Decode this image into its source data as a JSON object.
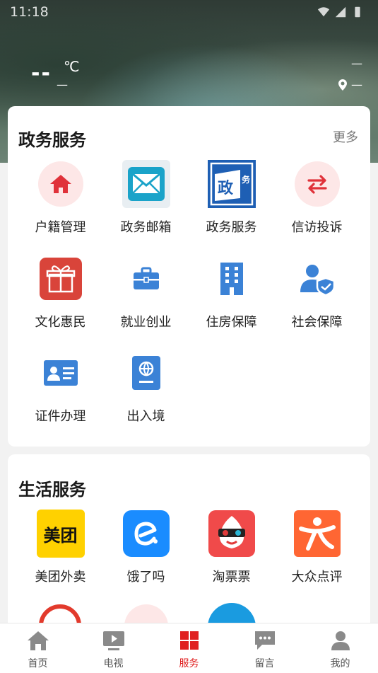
{
  "status_bar": {
    "time": "11:18"
  },
  "weather": {
    "temperature": "--",
    "unit": "℃",
    "description": "—",
    "right_top": "—",
    "location": "—"
  },
  "gov_services": {
    "title": "政务服务",
    "more": "更多",
    "items": [
      {
        "label": "户籍管理",
        "icon": "home-icon"
      },
      {
        "label": "政务邮箱",
        "icon": "mail-icon"
      },
      {
        "label": "政务服务",
        "icon": "gov-service-logo-icon"
      },
      {
        "label": "信访投诉",
        "icon": "exchange-arrows-icon"
      },
      {
        "label": "文化惠民",
        "icon": "gift-icon"
      },
      {
        "label": "就业创业",
        "icon": "briefcase-icon"
      },
      {
        "label": "住房保障",
        "icon": "building-icon"
      },
      {
        "label": "社会保障",
        "icon": "person-shield-icon"
      },
      {
        "label": "证件办理",
        "icon": "id-card-icon"
      },
      {
        "label": "出入境",
        "icon": "passport-icon"
      }
    ]
  },
  "life_services": {
    "title": "生活服务",
    "items": [
      {
        "label": "美团外卖",
        "icon": "meituan-icon",
        "logo_text": "美团"
      },
      {
        "label": "饿了吗",
        "icon": "eleme-icon"
      },
      {
        "label": "淘票票",
        "icon": "taopiaopiao-icon"
      },
      {
        "label": "大众点评",
        "icon": "dianping-icon"
      }
    ]
  },
  "bottom_nav": {
    "items": [
      {
        "label": "首页",
        "icon": "home-nav-icon"
      },
      {
        "label": "电视",
        "icon": "tv-play-icon"
      },
      {
        "label": "服务",
        "icon": "grid-icon",
        "active": true
      },
      {
        "label": "留言",
        "icon": "chat-icon"
      },
      {
        "label": "我的",
        "icon": "user-icon"
      }
    ]
  },
  "colors": {
    "accent_red": "#e02020",
    "icon_blue": "#3b82d6"
  }
}
